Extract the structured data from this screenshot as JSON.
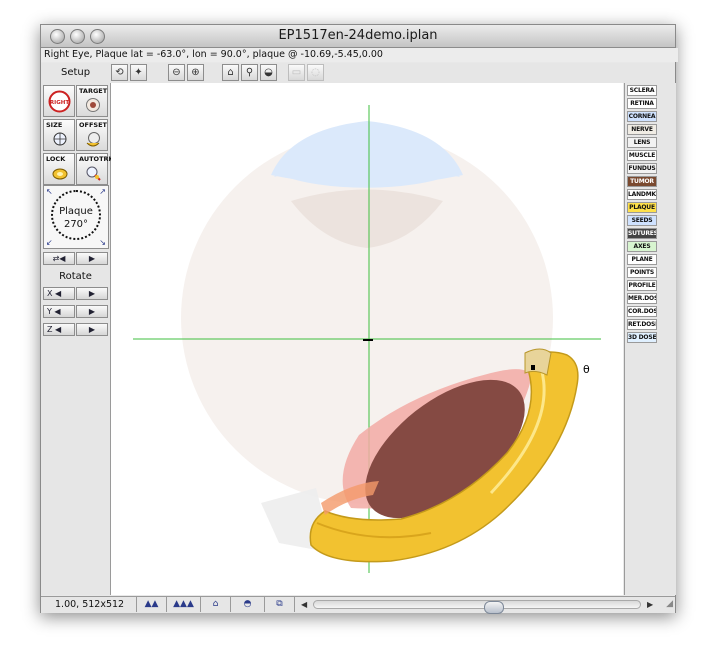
{
  "window": {
    "title": "EP1517en-24demo.iplan",
    "status": "Right Eye, Plaque lat = -63.0°, lon = 90.0°, plaque @ -10.69,-5.45,0.00"
  },
  "toolbar": {
    "setup_label": "Setup",
    "buttons": [
      {
        "name": "rotate-view-icon",
        "glyph": "⟲",
        "disabled": false
      },
      {
        "name": "light-icon",
        "glyph": "✦",
        "disabled": false
      },
      {
        "name": "zoom-out-icon",
        "glyph": "⊖",
        "disabled": false
      },
      {
        "name": "zoom-in-icon",
        "glyph": "⊕",
        "disabled": false
      },
      {
        "name": "home-view-icon",
        "glyph": "⌂",
        "disabled": false
      },
      {
        "name": "search-icon",
        "glyph": "⚲",
        "disabled": false
      },
      {
        "name": "view-icon",
        "glyph": "◒",
        "disabled": false
      },
      {
        "name": "disabled-tool-icon",
        "glyph": "▭",
        "disabled": true
      },
      {
        "name": "disabled-tool2-icon",
        "glyph": "◌",
        "disabled": true
      }
    ]
  },
  "left_panel": {
    "tiles": {
      "eye_side": {
        "label": "",
        "glyph": "RIGHT"
      },
      "target": {
        "label": "TARGET"
      },
      "size": {
        "label": "SIZE"
      },
      "offset": {
        "label": "OFFSET"
      },
      "lock": {
        "label": "LOCK"
      },
      "autotrk": {
        "label": "AUTOTRK"
      }
    },
    "dial": {
      "line1": "Plaque",
      "line2": "270°"
    },
    "rotate_label": "Rotate",
    "axes": [
      "X",
      "Y",
      "Z"
    ]
  },
  "right_panel": {
    "layers": [
      {
        "label": "SCLERA",
        "bg": "#ffffff"
      },
      {
        "label": "RETINA",
        "bg": "#ffffff"
      },
      {
        "label": "CORNEA",
        "bg": "#cfe2ff"
      },
      {
        "label": "NERVE",
        "bg": "#f0ece4"
      },
      {
        "label": "LENS",
        "bg": "#f2f2f2"
      },
      {
        "label": "MUSCLE",
        "bg": "#ffffff"
      },
      {
        "label": "FUNDUS",
        "bg": "#f2f2f2"
      },
      {
        "label": "TUMOR",
        "bg": "#7a4a30"
      },
      {
        "label": "LANDMK",
        "bg": "#ffffff"
      },
      {
        "label": "PLAQUE",
        "bg": "#ffe14a"
      },
      {
        "label": "SEEDS",
        "bg": "#cfe2ff"
      },
      {
        "label": "SUTURES",
        "bg": "#444444"
      },
      {
        "label": "AXES",
        "bg": "#d8f5d0"
      },
      {
        "label": "PLANE",
        "bg": "#ffffff"
      },
      {
        "label": "POINTS",
        "bg": "#ffffff"
      },
      {
        "label": "PROFILE",
        "bg": "#ffffff"
      },
      {
        "label": "MER.DOSE",
        "bg": "#ffffff"
      },
      {
        "label": "COR.DOSE",
        "bg": "#ffffff"
      },
      {
        "label": "RET.DOSE",
        "bg": "#ffffff"
      },
      {
        "label": "3D DOSE",
        "bg": "#e0f0ff"
      }
    ]
  },
  "bottom_bar": {
    "status": "1.00, 512x512",
    "buttons": [
      {
        "name": "mountain-small-icon",
        "glyph": "▲▲"
      },
      {
        "name": "mountain-large-icon",
        "glyph": "▲▲▲"
      },
      {
        "name": "home-icon",
        "glyph": "⌂"
      },
      {
        "name": "plaque-icon",
        "glyph": "◓"
      },
      {
        "name": "copy-view-icon",
        "glyph": "⧉"
      }
    ]
  },
  "viewport": {
    "colors": {
      "sclera": "#f6f1ee",
      "cornea": "#dbe9fb",
      "lens": "#ebe1dc",
      "axes": "#3fbf3f",
      "tumor": "#854a43",
      "tumor_shadow": "#f2aaa4",
      "plaque": "#f2c230",
      "nerve": "#ededed"
    }
  }
}
